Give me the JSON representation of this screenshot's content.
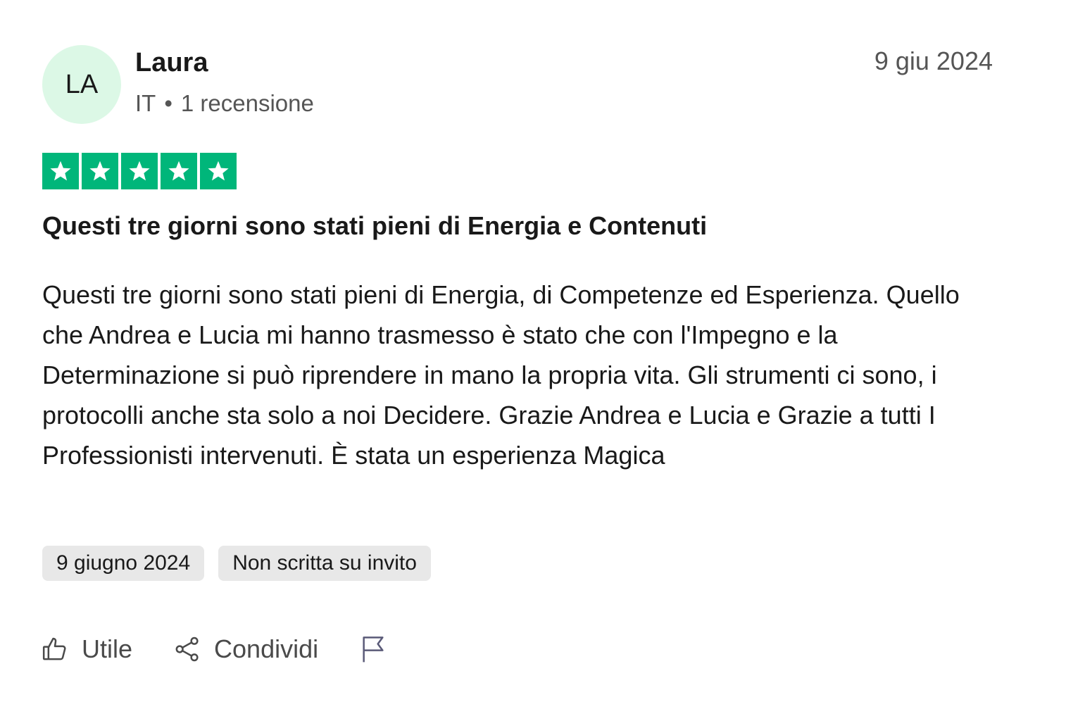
{
  "author": {
    "initials": "LA",
    "name": "Laura",
    "country": "IT",
    "separator": "•",
    "review_count": "1 recensione"
  },
  "date_short": "9 giu 2024",
  "rating": {
    "stars": 5,
    "max": 5,
    "color": "#00b67a"
  },
  "review": {
    "title": "Questi tre giorni sono stati pieni di Energia e Contenuti",
    "body": "Questi tre giorni sono stati pieni di Energia, di Competenze ed Esperienza. Quello che Andrea e Lucia mi hanno trasmesso è stato che con l'Impegno e la Determinazione si può riprendere in mano la propria vita. Gli strumenti ci sono, i protocolli anche sta solo a noi Decidere. Grazie Andrea e Lucia e Grazie a tutti I Professionisti intervenuti. È stata un esperienza Magica"
  },
  "tags": {
    "date": "9 giugno 2024",
    "invite": "Non scritta su invito"
  },
  "actions": {
    "useful_label": "Utile",
    "useful_icon": "thumbs-up-icon",
    "share_label": "Condividi",
    "share_icon": "share-icon",
    "report_icon": "flag-icon"
  },
  "colors": {
    "avatar_bg": "#dcf8e6",
    "tag_bg": "#e8e8e8",
    "text": "#191919",
    "muted": "#555555"
  }
}
